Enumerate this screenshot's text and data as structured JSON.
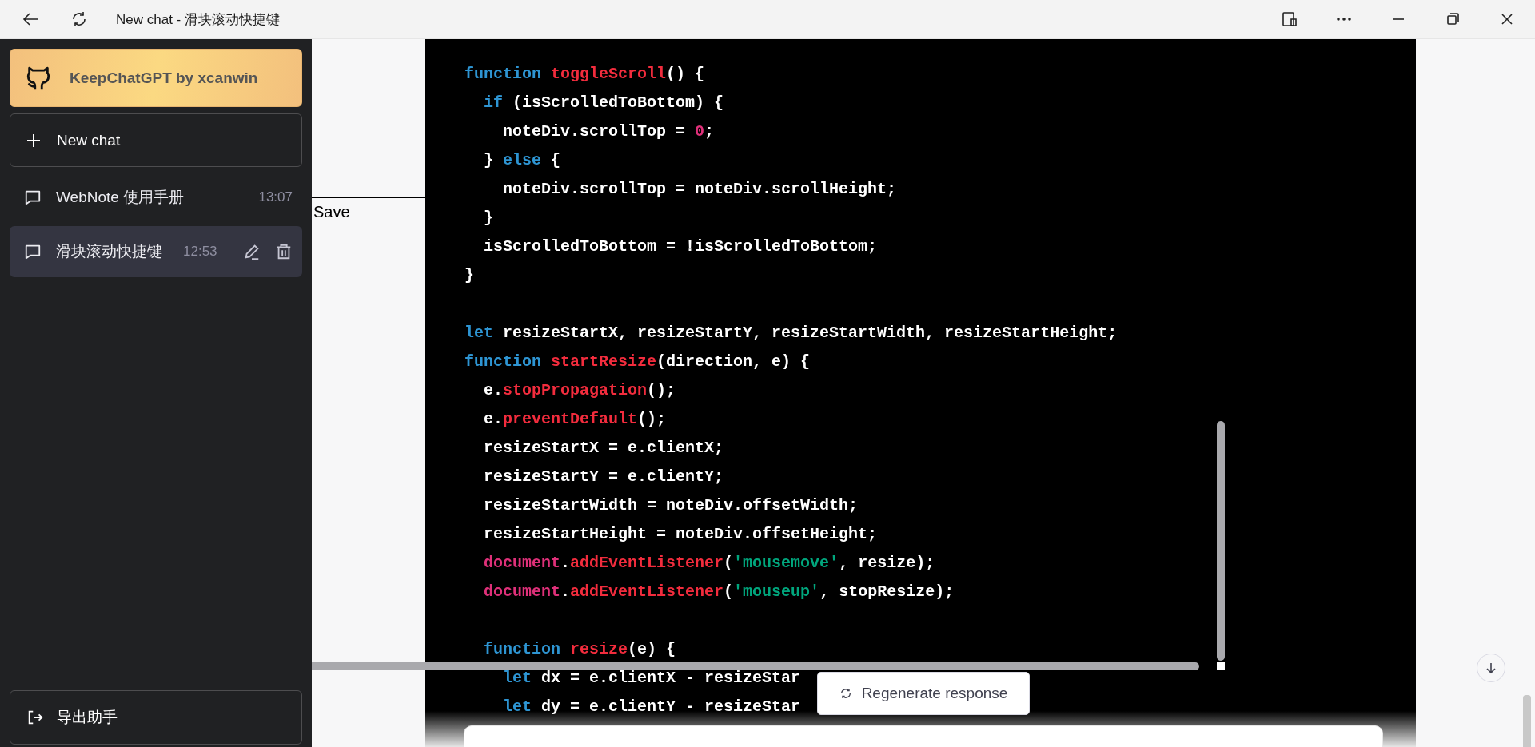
{
  "window": {
    "title": "New chat - 滑块滚动快捷键"
  },
  "sidebar": {
    "banner": "KeepChatGPT by xcanwin",
    "new_chat": "New chat",
    "chats": [
      {
        "title": "WebNote 使用手册",
        "time": "13:07",
        "selected": false
      },
      {
        "title": "滑块滚动快捷键",
        "time": "12:53",
        "selected": true
      }
    ],
    "export_button": "导出助手"
  },
  "note_overlay": {
    "save_button": "Save"
  },
  "code": {
    "lines": [
      {
        "tokens": [
          {
            "kind": "keyword",
            "text": "function "
          },
          {
            "kind": "title",
            "text": "toggleScroll"
          },
          {
            "kind": "plain",
            "text": "() {"
          }
        ]
      },
      {
        "tokens": [
          {
            "kind": "keyword",
            "text": "  if"
          },
          {
            "kind": "plain",
            "text": " (isScrolledToBottom) {"
          }
        ]
      },
      {
        "tokens": [
          {
            "kind": "plain",
            "text": "    noteDiv.scrollTop = "
          },
          {
            "kind": "number",
            "text": "0"
          },
          {
            "kind": "plain",
            "text": ";"
          }
        ]
      },
      {
        "tokens": [
          {
            "kind": "plain",
            "text": "  } "
          },
          {
            "kind": "keyword",
            "text": "else"
          },
          {
            "kind": "plain",
            "text": " {"
          }
        ]
      },
      {
        "tokens": [
          {
            "kind": "plain",
            "text": "    noteDiv.scrollTop = noteDiv.scrollHeight;"
          }
        ]
      },
      {
        "tokens": [
          {
            "kind": "plain",
            "text": "  }"
          }
        ]
      },
      {
        "tokens": [
          {
            "kind": "plain",
            "text": "  isScrolledToBottom = !isScrolledToBottom;"
          }
        ]
      },
      {
        "tokens": [
          {
            "kind": "plain",
            "text": "}"
          }
        ]
      },
      {
        "blank_before": true,
        "tokens": [
          {
            "kind": "keyword",
            "text": "let"
          },
          {
            "kind": "plain",
            "text": " resizeStartX, resizeStartY, resizeStartWidth, resizeStartHeight;"
          }
        ]
      },
      {
        "tokens": [
          {
            "kind": "keyword",
            "text": "function "
          },
          {
            "kind": "title",
            "text": "startResize"
          },
          {
            "kind": "plain",
            "text": "(direction, e) {"
          }
        ]
      },
      {
        "tokens": [
          {
            "kind": "plain",
            "text": "  e."
          },
          {
            "kind": "title",
            "text": "stopPropagation"
          },
          {
            "kind": "plain",
            "text": "();"
          }
        ]
      },
      {
        "tokens": [
          {
            "kind": "plain",
            "text": "  e."
          },
          {
            "kind": "title",
            "text": "preventDefault"
          },
          {
            "kind": "plain",
            "text": "();"
          }
        ]
      },
      {
        "tokens": [
          {
            "kind": "plain",
            "text": "  resizeStartX = e.clientX;"
          }
        ]
      },
      {
        "tokens": [
          {
            "kind": "plain",
            "text": "  resizeStartY = e.clientY;"
          }
        ]
      },
      {
        "tokens": [
          {
            "kind": "plain",
            "text": "  resizeStartWidth = noteDiv.offsetWidth;"
          }
        ]
      },
      {
        "tokens": [
          {
            "kind": "plain",
            "text": "  resizeStartHeight = noteDiv.offsetHeight;"
          }
        ]
      },
      {
        "tokens": [
          {
            "kind": "builtin",
            "text": "  document"
          },
          {
            "kind": "plain",
            "text": "."
          },
          {
            "kind": "title",
            "text": "addEventListener"
          },
          {
            "kind": "plain",
            "text": "("
          },
          {
            "kind": "string",
            "text": "'mousemove'"
          },
          {
            "kind": "plain",
            "text": ", resize);"
          }
        ]
      },
      {
        "tokens": [
          {
            "kind": "builtin",
            "text": "  document"
          },
          {
            "kind": "plain",
            "text": "."
          },
          {
            "kind": "title",
            "text": "addEventListener"
          },
          {
            "kind": "plain",
            "text": "("
          },
          {
            "kind": "string",
            "text": "'mouseup'"
          },
          {
            "kind": "plain",
            "text": ", stopResize);"
          }
        ]
      },
      {
        "blank_before": true,
        "tokens": [
          {
            "kind": "keyword",
            "text": "  function "
          },
          {
            "kind": "title",
            "text": "resize"
          },
          {
            "kind": "plain",
            "text": "(e) {"
          }
        ]
      },
      {
        "tokens": [
          {
            "kind": "keyword",
            "text": "    let"
          },
          {
            "kind": "plain",
            "text": " dx = e.clientX - resizeStar"
          }
        ]
      },
      {
        "tokens": [
          {
            "kind": "keyword",
            "text": "    let"
          },
          {
            "kind": "plain",
            "text": " dy = e.clientY - resizeStar"
          }
        ]
      }
    ]
  },
  "regenerate_button": "Regenerate response"
}
